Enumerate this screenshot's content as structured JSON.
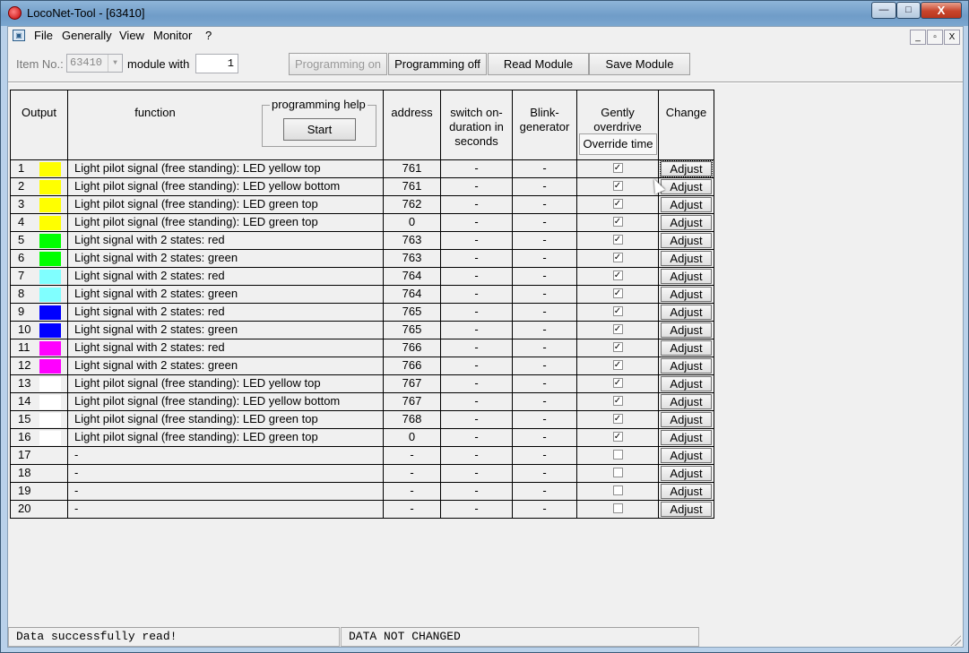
{
  "window": {
    "title": "LocoNet-Tool - [63410]",
    "minimize_label": "—",
    "maximize_label": "□",
    "close_label": "X"
  },
  "menu": {
    "items": [
      "File",
      "Generally",
      "View",
      "Monitor",
      "?"
    ],
    "mdi_buttons": [
      "_",
      "▫",
      "X"
    ]
  },
  "toolbar": {
    "item_no_label": "Item No.:",
    "item_no_value": "63410",
    "module_with_label": "module with",
    "module_with_value": "1",
    "programming_on_label": "Programming on",
    "programming_off_label": "Programming off",
    "read_module_label": "Read Module",
    "save_module_label": "Save Module"
  },
  "grid": {
    "headers": {
      "output": "Output",
      "function": "function",
      "programming_help": "programming help",
      "start": "Start",
      "address": "address",
      "switch_on": "switch on-duration in seconds",
      "blink": "Blink-generator",
      "gently": "Gently overdrive",
      "override_time": "Override time",
      "change": "Change"
    },
    "adjust_label": "Adjust",
    "rows": [
      {
        "num": "1",
        "color": "#ffff00",
        "function": "Light pilot signal (free standing): LED yellow top",
        "address": "761",
        "switch": "-",
        "blink": "-",
        "gently": true
      },
      {
        "num": "2",
        "color": "#ffff00",
        "function": "Light pilot signal (free standing): LED yellow bottom",
        "address": "761",
        "switch": "-",
        "blink": "-",
        "gently": true
      },
      {
        "num": "3",
        "color": "#ffff00",
        "function": "Light pilot signal (free standing): LED green top",
        "address": "762",
        "switch": "-",
        "blink": "-",
        "gently": true
      },
      {
        "num": "4",
        "color": "#ffff00",
        "function": "Light pilot signal (free standing): LED green top",
        "address": "0",
        "switch": "-",
        "blink": "-",
        "gently": true
      },
      {
        "num": "5",
        "color": "#00ff00",
        "function": "Light signal with 2 states: red",
        "address": "763",
        "switch": "-",
        "blink": "-",
        "gently": true
      },
      {
        "num": "6",
        "color": "#00ff00",
        "function": "Light signal with 2 states: green",
        "address": "763",
        "switch": "-",
        "blink": "-",
        "gently": true
      },
      {
        "num": "7",
        "color": "#80ffff",
        "function": "Light signal with 2 states: red",
        "address": "764",
        "switch": "-",
        "blink": "-",
        "gently": true
      },
      {
        "num": "8",
        "color": "#80ffff",
        "function": "Light signal with 2 states: green",
        "address": "764",
        "switch": "-",
        "blink": "-",
        "gently": true
      },
      {
        "num": "9",
        "color": "#0000ff",
        "function": "Light signal with 2 states: red",
        "address": "765",
        "switch": "-",
        "blink": "-",
        "gently": true
      },
      {
        "num": "10",
        "color": "#0000ff",
        "function": "Light signal with 2 states: green",
        "address": "765",
        "switch": "-",
        "blink": "-",
        "gently": true
      },
      {
        "num": "11",
        "color": "#ff00ff",
        "function": "Light signal with 2 states: red",
        "address": "766",
        "switch": "-",
        "blink": "-",
        "gently": true
      },
      {
        "num": "12",
        "color": "#ff00ff",
        "function": "Light signal with 2 states: green",
        "address": "766",
        "switch": "-",
        "blink": "-",
        "gently": true
      },
      {
        "num": "13",
        "color": "#ffffff",
        "function": "Light pilot signal (free standing): LED yellow top",
        "address": "767",
        "switch": "-",
        "blink": "-",
        "gently": true
      },
      {
        "num": "14",
        "color": "#ffffff",
        "function": "Light pilot signal (free standing): LED yellow bottom",
        "address": "767",
        "switch": "-",
        "blink": "-",
        "gently": true
      },
      {
        "num": "15",
        "color": "#ffffff",
        "function": "Light pilot signal (free standing): LED green top",
        "address": "768",
        "switch": "-",
        "blink": "-",
        "gently": true
      },
      {
        "num": "16",
        "color": "#ffffff",
        "function": "Light pilot signal (free standing): LED green top",
        "address": "0",
        "switch": "-",
        "blink": "-",
        "gently": true
      },
      {
        "num": "17",
        "color": "",
        "function": "-",
        "address": "-",
        "switch": "-",
        "blink": "-",
        "gently": false
      },
      {
        "num": "18",
        "color": "",
        "function": "-",
        "address": "-",
        "switch": "-",
        "blink": "-",
        "gently": false
      },
      {
        "num": "19",
        "color": "",
        "function": "-",
        "address": "-",
        "switch": "-",
        "blink": "-",
        "gently": false
      },
      {
        "num": "20",
        "color": "",
        "function": "-",
        "address": "-",
        "switch": "-",
        "blink": "-",
        "gently": false
      }
    ]
  },
  "status": {
    "left": "Data successfully read!",
    "right": "DATA NOT CHANGED"
  },
  "icons": {
    "app": "loconet-app-icon",
    "menu": "module-doc-icon",
    "cursor": "mouse-pointer-icon"
  }
}
